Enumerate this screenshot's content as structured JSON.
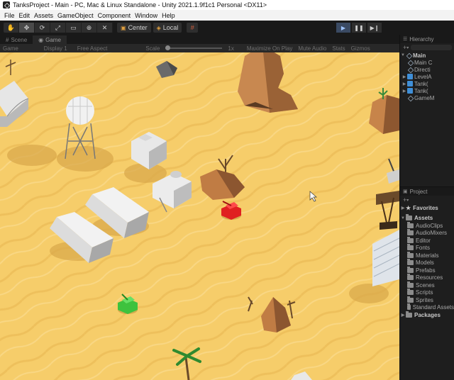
{
  "window": {
    "title": "TanksProject - Main - PC, Mac & Linux Standalone - Unity 2021.1.9f1c1 Personal <DX11>"
  },
  "menu": [
    "File",
    "Edit",
    "Assets",
    "GameObject",
    "Component",
    "Window",
    "Help"
  ],
  "toolbar": {
    "tools": [
      "hand-icon",
      "move-icon",
      "rotate-icon",
      "scale-icon",
      "rect-icon",
      "transform-icon",
      "custom-tool-icon"
    ],
    "pivot_label": "Center",
    "space_label": "Local"
  },
  "tabs": {
    "scene": "Scene",
    "game": "Game"
  },
  "gamebar": {
    "display_mode": "Game",
    "display": "Display 1",
    "aspect": "Free Aspect",
    "scale_label": "Scale",
    "scale_value": "1x",
    "maximize": "Maximize On Play",
    "mute": "Mute Audio",
    "stats": "Stats",
    "gizmos": "Gizmos"
  },
  "hierarchy": {
    "title": "Hierarchy",
    "root": "Main",
    "items": [
      "Main C",
      "Directi",
      "LevelA",
      "Tank(",
      "Tank(",
      "GameM"
    ]
  },
  "project": {
    "title": "Project",
    "favorites": "Favorites",
    "assets": "Assets",
    "folders": [
      "AudioClips",
      "AudioMixers",
      "Editor",
      "Fonts",
      "Materials",
      "Models",
      "Prefabs",
      "Resources",
      "Scenes",
      "Scripts",
      "Sprites",
      "Standard Assets"
    ],
    "packages": "Packages"
  },
  "colors": {
    "sand": "#f6cd6a",
    "tank_red": "#e02020",
    "tank_green": "#3ec23e",
    "play_active": "#9ec4ff"
  }
}
